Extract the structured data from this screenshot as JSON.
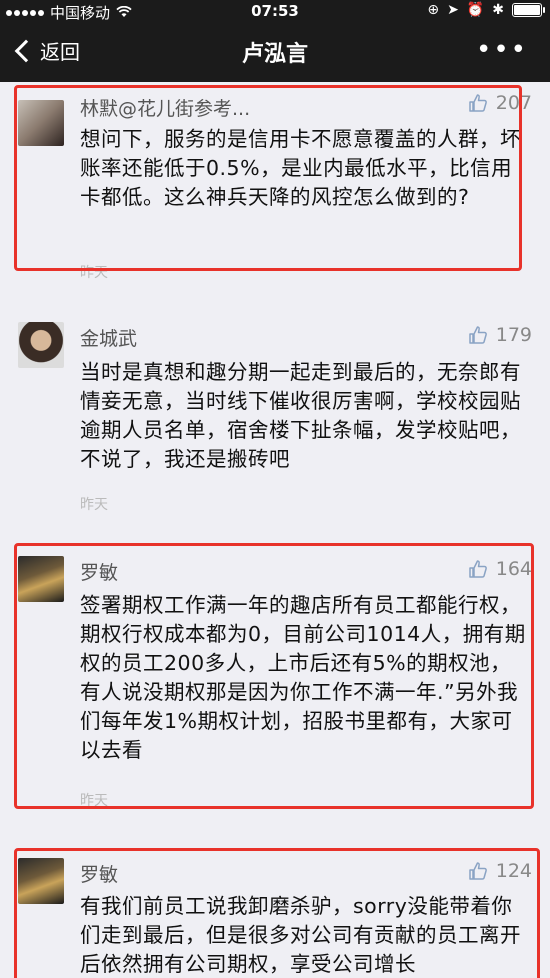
{
  "status": {
    "carrier": "中国移动",
    "time": "07:53",
    "battery": "full"
  },
  "nav": {
    "back_label": "返回",
    "title": "卢泓言",
    "more_label": "•••"
  },
  "comments": [
    {
      "name": "林默@花儿街参考...",
      "likes": "207",
      "text": "想问下，服务的是信用卡不愿意覆盖的人群，坏账率还能低于0.5%，是业内最低水平，比信用卡都低。这么神兵天降的风控怎么做到的?",
      "date": "昨天",
      "highlighted": true
    },
    {
      "name": "金城武",
      "likes": "179",
      "text": "当时是真想和趣分期一起走到最后的，无奈郎有情妾无意，当时线下催收很厉害啊，学校校园贴逾期人员名单，宿舍楼下扯条幅，发学校贴吧，不说了，我还是搬砖吧",
      "date": "昨天",
      "highlighted": false
    },
    {
      "name": "罗敏",
      "likes": "164",
      "text": "签署期权工作满一年的趣店所有员工都能行权，期权行权成本都为0，目前公司1014人，拥有期权的员工200多人，上市后还有5%的期权池，有人说没期权那是因为你工作不满一年.”另外我们每年发1%期权计划，招股书里都有，大家可以去看",
      "date": "昨天",
      "highlighted": true
    },
    {
      "name": "罗敏",
      "likes": "124",
      "text": "有我们前员工说我卸磨杀驴，sorry没能带着你们走到最后，但是很多对公司有贡献的员工离开后依然拥有公司期权，享受公司增长",
      "date": "",
      "highlighted": true
    }
  ],
  "colors": {
    "bar": "#1b1b1b",
    "background": "#efeff4",
    "highlight": "#e8322a",
    "meta": "#888888"
  },
  "icons": [
    "signal-icon",
    "wifi-icon",
    "location-icon",
    "alarm-icon",
    "bluetooth-icon",
    "battery-icon",
    "back-chevron-icon",
    "more-icon",
    "thumbs-up-icon"
  ]
}
